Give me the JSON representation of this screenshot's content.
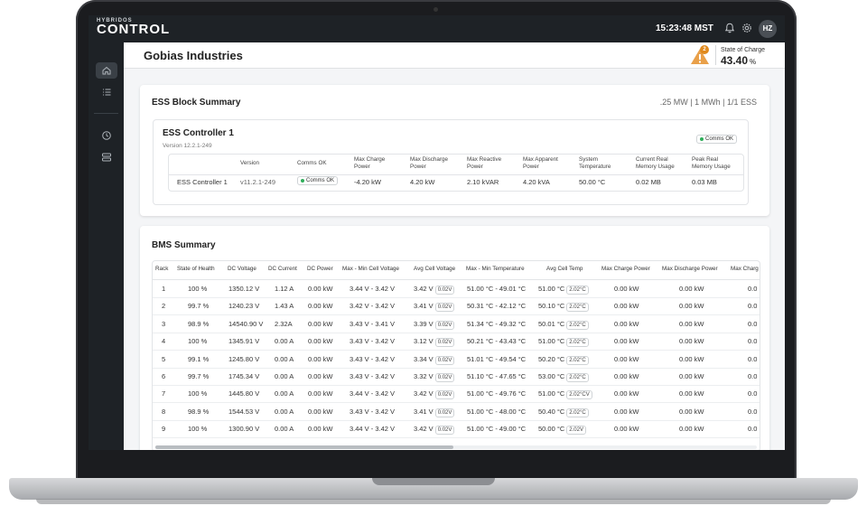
{
  "app": {
    "brand_small": "HYBRIDOS",
    "brand_big": "CONTROL",
    "clock": "15:23:48 MST",
    "user_initials": "HZ"
  },
  "header": {
    "company": "Gobias Industries",
    "alert_count": "2",
    "soc_label": "State of Charge",
    "soc_value": "43.40",
    "soc_unit": "%"
  },
  "ess": {
    "title": "ESS Block Summary",
    "meta": ".25 MW | 1 MWh | 1/1 ESS",
    "controller_title": "ESS Controller 1",
    "controller_version": "Version 12.2.1-249",
    "controller_status": "Comms OK",
    "headers": [
      "Version",
      "Comms OK",
      "Max Charge Power",
      "Max Discharge Power",
      "Max Reactive Power",
      "Max Apparent Power",
      "System Temperature",
      "Current Real Memory Usage",
      "Peak Real Memory Usage"
    ],
    "row": {
      "name": "ESS Controller 1",
      "version": "v11.2.1-249",
      "comms": "Comms OK",
      "max_charge": "-4.20 kW",
      "max_discharge": "4.20 kW",
      "max_reactive": "2.10 kVAR",
      "max_apparent": "4.20 kVA",
      "temp": "50.00 °C",
      "cur_mem": "0.02 MB",
      "peak_mem": "0.03 MB"
    }
  },
  "bms": {
    "title": "BMS Summary",
    "headers": [
      "Rack",
      "State of Health",
      "DC Voltage",
      "DC Current",
      "DC Power",
      "Max - Min Cell Voltage",
      "Avg Cell Voltage",
      "Max - Min Temperature",
      "Avg Cell Temp",
      "Max Charge Power",
      "Max Discharge Power",
      "Max Charg"
    ],
    "rows": [
      {
        "rack": "1",
        "soh": "100 %",
        "dcv": "1350.12 V",
        "dci": "1.12 A",
        "dcp": "0.00 kW",
        "cellv": "3.44 V - 3.42 V",
        "avgv": "3.42 V",
        "avgv_tag": "0.02V",
        "temp": "51.00 °C - 49.01 °C",
        "avgt": "51.00 °C",
        "avgt_tag": "2.02°C",
        "mcp": "0.00 kW",
        "mdp": "0.00 kW",
        "mc2": "0.0"
      },
      {
        "rack": "2",
        "soh": "99.7 %",
        "dcv": "1240.23 V",
        "dci": "1.43 A",
        "dcp": "0.00 kW",
        "cellv": "3.42 V - 3.42 V",
        "avgv": "3.41 V",
        "avgv_tag": "0.02V",
        "temp": "50.31 °C - 42.12 °C",
        "avgt": "50.10 °C",
        "avgt_tag": "2.02°C",
        "mcp": "0.00 kW",
        "mdp": "0.00 kW",
        "mc2": "0.0"
      },
      {
        "rack": "3",
        "soh": "98.9 %",
        "dcv": "14540.90 V",
        "dci": "2.32A",
        "dcp": "0.00 kW",
        "cellv": "3.43 V - 3.41 V",
        "avgv": "3.39 V",
        "avgv_tag": "0.02V",
        "temp": "51.34 °C - 49.32 °C",
        "avgt": "50.01 °C",
        "avgt_tag": "2.02°C",
        "mcp": "0.00 kW",
        "mdp": "0.00 kW",
        "mc2": "0.0"
      },
      {
        "rack": "4",
        "soh": "100 %",
        "dcv": "1345.91 V",
        "dci": "0.00 A",
        "dcp": "0.00 kW",
        "cellv": "3.43 V - 3.42 V",
        "avgv": "3.12 V",
        "avgv_tag": "0.02V",
        "temp": "50.21 °C - 43.43 °C",
        "avgt": "51.00 °C",
        "avgt_tag": "2.02°C",
        "mcp": "0.00 kW",
        "mdp": "0.00 kW",
        "mc2": "0.0"
      },
      {
        "rack": "5",
        "soh": "99.1 %",
        "dcv": "1245.80 V",
        "dci": "0.00 A",
        "dcp": "0.00 kW",
        "cellv": "3.43 V - 3.42 V",
        "avgv": "3.34 V",
        "avgv_tag": "0.02V",
        "temp": "51.01 °C - 49.54 °C",
        "avgt": "50.20 °C",
        "avgt_tag": "2.02°C",
        "mcp": "0.00 kW",
        "mdp": "0.00 kW",
        "mc2": "0.0"
      },
      {
        "rack": "6",
        "soh": "99.7 %",
        "dcv": "1745.34 V",
        "dci": "0.00 A",
        "dcp": "0.00 kW",
        "cellv": "3.43 V - 3.42 V",
        "avgv": "3.32 V",
        "avgv_tag": "0.02V",
        "temp": "51.10 °C - 47.65 °C",
        "avgt": "53.00 °C",
        "avgt_tag": "2.02°C",
        "mcp": "0.00 kW",
        "mdp": "0.00 kW",
        "mc2": "0.0"
      },
      {
        "rack": "7",
        "soh": "100 %",
        "dcv": "1445.80 V",
        "dci": "0.00 A",
        "dcp": "0.00 kW",
        "cellv": "3.44 V - 3.42 V",
        "avgv": "3.42 V",
        "avgv_tag": "0.02V",
        "temp": "51.00 °C - 49.76 °C",
        "avgt": "51.00 °C",
        "avgt_tag": "2.02°CV",
        "mcp": "0.00 kW",
        "mdp": "0.00 kW",
        "mc2": "0.0"
      },
      {
        "rack": "8",
        "soh": "98.9 %",
        "dcv": "1544.53 V",
        "dci": "0.00 A",
        "dcp": "0.00 kW",
        "cellv": "3.43 V - 3.42 V",
        "avgv": "3.41 V",
        "avgv_tag": "0.02V",
        "temp": "51.00 °C - 48.00 °C",
        "avgt": "50.40 °C",
        "avgt_tag": "2.02°C",
        "mcp": "0.00 kW",
        "mdp": "0.00 kW",
        "mc2": "0.0"
      },
      {
        "rack": "9",
        "soh": "100 %",
        "dcv": "1300.90 V",
        "dci": "0.00 A",
        "dcp": "0.00 kW",
        "cellv": "3.44 V - 3.42 V",
        "avgv": "3.42 V",
        "avgv_tag": "0.02V",
        "temp": "51.00 °C - 49.00 °C",
        "avgt": "50.00 °C",
        "avgt_tag": "2.02V",
        "mcp": "0.00 kW",
        "mdp": "0.00 kW",
        "mc2": "0.0"
      }
    ]
  },
  "sidebar": {
    "items": [
      {
        "icon": "home-icon"
      },
      {
        "icon": "list-icon"
      },
      {
        "icon": "history-icon"
      },
      {
        "icon": "settings-panel-icon"
      }
    ]
  },
  "colors": {
    "accent_ok": "#2fae5a",
    "warning": "#e08a1e",
    "chrome": "#1e2226"
  }
}
